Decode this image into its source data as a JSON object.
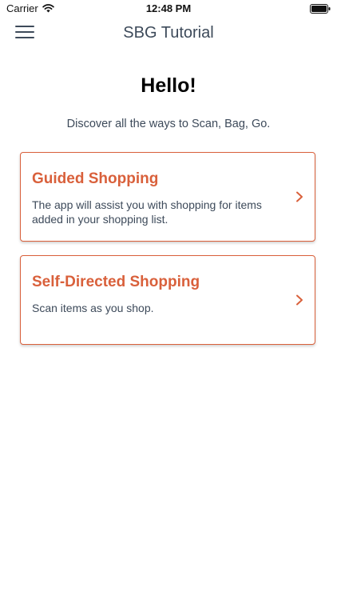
{
  "status_bar": {
    "carrier": "Carrier",
    "time": "12:48 PM",
    "wifi_icon": "wifi-icon",
    "battery_icon": "battery-icon"
  },
  "nav": {
    "title": "SBG Tutorial",
    "menu_icon": "hamburger-menu-icon"
  },
  "main": {
    "greeting": "Hello!",
    "subtitle": "Discover all the ways to Scan, Bag, Go.",
    "cards": [
      {
        "title": "Guided Shopping",
        "description": "The app will assist you with shopping for items added in your shopping list.",
        "icon": "chevron-right-icon"
      },
      {
        "title": "Self-Directed Shopping",
        "description": "Scan items as you shop.",
        "icon": "chevron-right-icon"
      }
    ]
  },
  "colors": {
    "accent": "#d9603b",
    "text_secondary": "#3d4a5a",
    "background": "#ffffff"
  }
}
